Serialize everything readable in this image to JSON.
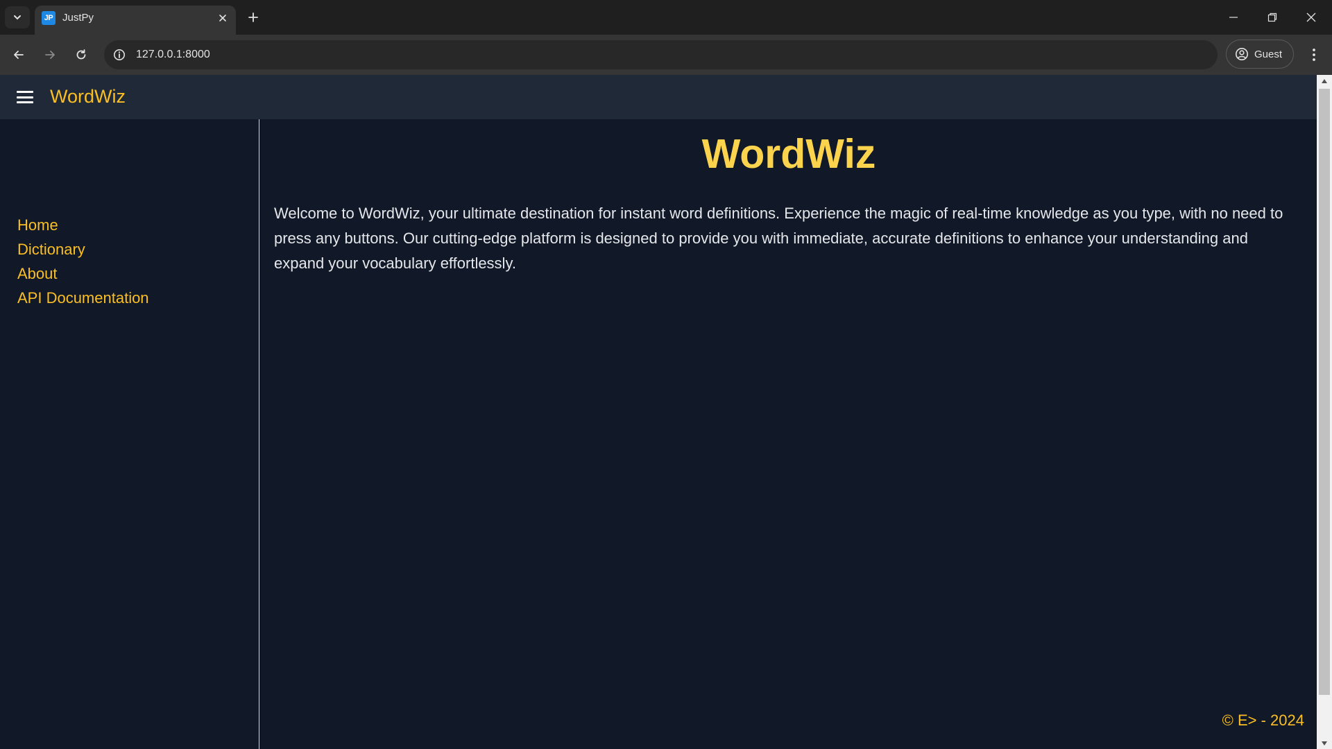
{
  "browser": {
    "tab_title": "JustPy",
    "favicon_text": "JP",
    "url": "127.0.0.1:8000",
    "profile_label": "Guest",
    "icons": {
      "tab_search": "chevron-down-icon",
      "tab_close": "close-icon",
      "new_tab": "plus-icon",
      "minimize": "minimize-icon",
      "restore": "restore-icon",
      "close_window": "close-icon",
      "back": "arrow-left-icon",
      "forward": "arrow-right-icon",
      "reload": "reload-icon",
      "site_info": "info-icon",
      "profile": "person-circle-icon",
      "menu": "kebab-menu-icon"
    }
  },
  "app": {
    "brand": "WordWiz",
    "menu_icon": "hamburger-icon",
    "sidebar": {
      "items": [
        {
          "label": "Home"
        },
        {
          "label": "Dictionary"
        },
        {
          "label": "About"
        },
        {
          "label": "API Documentation"
        }
      ]
    },
    "main": {
      "title": "WordWiz",
      "intro": "Welcome to WordWiz, your ultimate destination for instant word definitions. Experience the magic of real-time knowledge as you type, with no need to press any buttons. Our cutting-edge platform is designed to provide you with immediate, accurate definitions to enhance your understanding and expand your vocabulary effortlessly."
    },
    "footer": "© E> - 2024"
  },
  "colors": {
    "page_background": "#111827",
    "header_background": "#1f2937",
    "accent": "#fbbf24",
    "title": "#fcd34d",
    "body_text": "#e5e7eb"
  }
}
